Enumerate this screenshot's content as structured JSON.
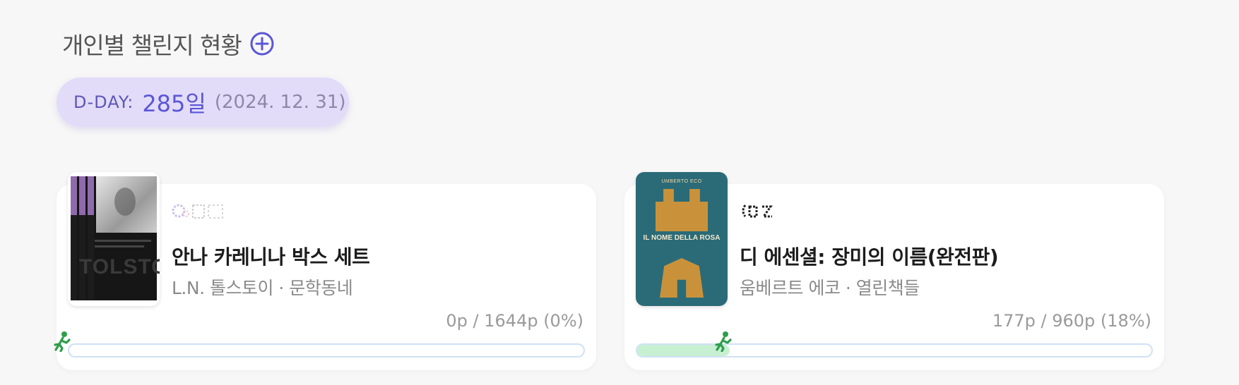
{
  "header": {
    "title": "개인별 챌린지 현황",
    "add_icon": "plus-circle-icon"
  },
  "dday": {
    "label": "D-DAY:",
    "value": "285일",
    "date": "(2024. 12. 31)"
  },
  "colors": {
    "accent": "#5b56d6",
    "pill_bg": "#e2dcf9",
    "progress_fill": "#c7f0d2",
    "progress_border": "#cfe1f6",
    "runner": "#2e9e4a"
  },
  "books": [
    {
      "status_icon": "reading-status-icon",
      "title": "안나 카레니나 박스 세트",
      "meta": "L.N. 톨스토이 · 문학동네",
      "progress_text": "0p / 1644p (0%)",
      "progress": 0.0,
      "cover_text": "TOLSTOY"
    },
    {
      "status_icon": "reading-status-icon",
      "title": "디 에센셜: 장미의 이름(완전판)",
      "meta": "움베르트 에코 · 열린책들",
      "progress_text": "177p / 960p (18%)",
      "progress": 0.18,
      "cover_text": "IL NOME DELLA ROSA",
      "cover_author": "UMBERTO ECO"
    }
  ]
}
